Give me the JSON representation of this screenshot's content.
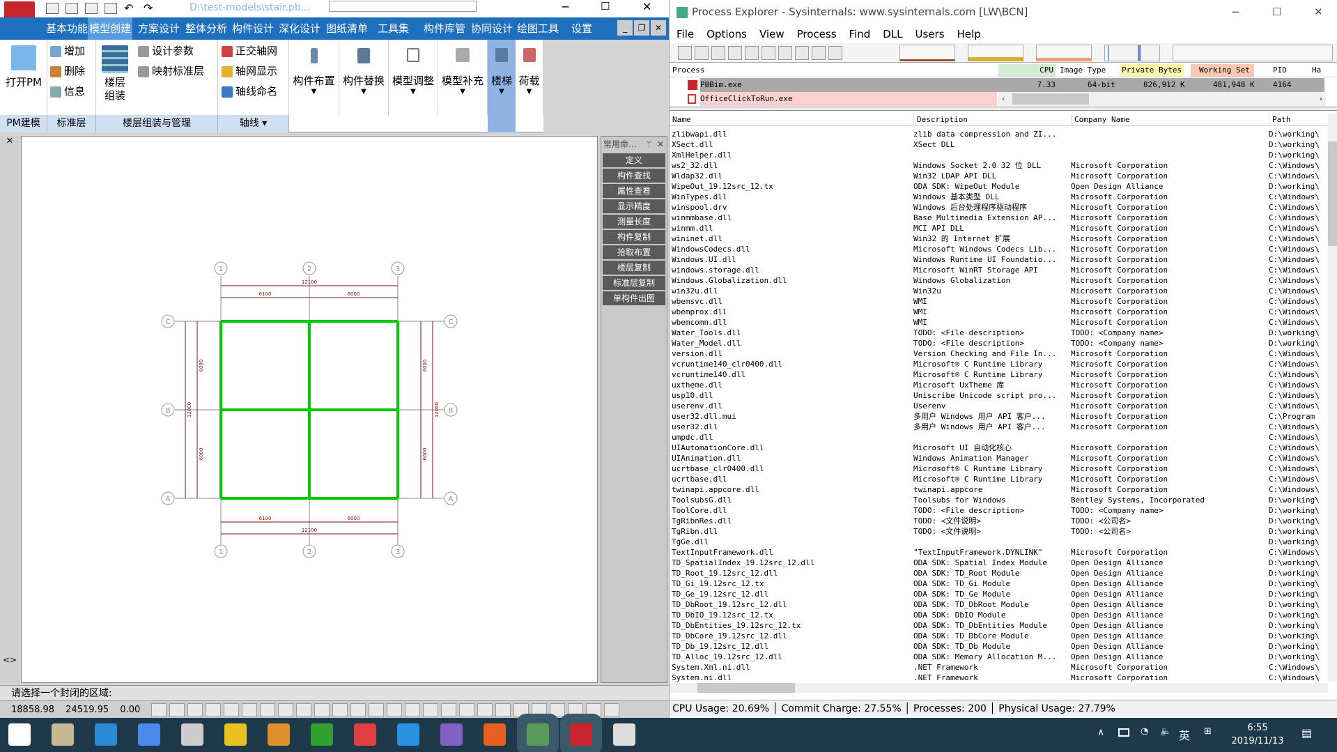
{
  "left_app": {
    "file_path": "D:\\test-models\\stair.pb...",
    "tabs": [
      "基本功能",
      "模型创建",
      "方案设计",
      "整体分析",
      "构件设计",
      "深化设计",
      "图纸清单",
      "工具集",
      "构件库管",
      "协同设计",
      "绘图工具",
      "设置"
    ],
    "selected_tab": "模型创建",
    "ribbon": {
      "open_pm": "打开PM",
      "add": "增加",
      "delete": "删除",
      "info": "信息",
      "floor_assembly": "楼层组装",
      "design_params": "设计参数",
      "map_std_floor": "映射标准层",
      "ortho_grid": "正交轴网",
      "grid_display": "轴网显示",
      "axis_naming": "轴线命名",
      "member_layout": "构件布置",
      "member_replace": "构件替换",
      "model_adjust": "模型调整",
      "model_supplement": "模型补充",
      "stair": "楼梯",
      "load": "荷载"
    },
    "groups": [
      "PM建模",
      "标准层",
      "楼层组装与管理",
      "轴线"
    ],
    "side_panel": {
      "title": "常用命...",
      "buttons": [
        "定义",
        "构件查找",
        "属性查看",
        "显示精度",
        "测量长度",
        "构件复制",
        "拾取布置",
        "楼层复制",
        "标准层复制",
        "单构件出图"
      ]
    },
    "drawing": {
      "col_labels": [
        "1",
        "2",
        "3"
      ],
      "row_labels": [
        "C",
        "B",
        "A"
      ],
      "dims_top": [
        "12100",
        "6100",
        "6000"
      ],
      "dims_bottom": [
        "12100",
        "6100",
        "6000"
      ],
      "dims_left": [
        "12000",
        "6000",
        "6000"
      ],
      "dims_right": [
        "12000",
        "6000",
        "6000"
      ],
      "beam_color": "#00c800"
    },
    "prompt": "请选择一个封闭的区域:",
    "coords": {
      "x": "18858.98",
      "y": "24519.95",
      "z": "0.00"
    }
  },
  "process_explorer": {
    "title": "Process Explorer - Sysinternals: www.sysinternals.com [LW\\BCN]",
    "menu": [
      "File",
      "Options",
      "View",
      "Process",
      "Find",
      "DLL",
      "Users",
      "Help"
    ],
    "process_columns": [
      "Process",
      "CPU",
      "Image Type",
      "Private Bytes",
      "Working Set",
      "PID",
      "Ha"
    ],
    "processes": [
      {
        "name": "PBBim.exe",
        "cpu": "7.33",
        "image_type": "64-bit",
        "private_bytes": "826,912 K",
        "working_set": "481,948 K",
        "pid": "4164"
      },
      {
        "name": "OfficeClickToRun.exe"
      }
    ],
    "dll_columns": [
      "Name",
      "Description",
      "Company Name",
      "Path"
    ],
    "dlls": [
      [
        "zlibwapi.dll",
        "zlib data compression and ZI...",
        "",
        "D:\\working\\"
      ],
      [
        "XSect.dll",
        "XSect DLL",
        "",
        "D:\\working\\"
      ],
      [
        "XmlHelper.dll",
        "",
        "",
        "D:\\working\\"
      ],
      [
        "ws2_32.dll",
        "Windows Socket 2.0 32 位 DLL",
        "Microsoft Corporation",
        "C:\\Windows\\"
      ],
      [
        "Wldap32.dll",
        "Win32 LDAP API DLL",
        "Microsoft Corporation",
        "C:\\Windows\\"
      ],
      [
        "WipeOut_19.12src_12.tx",
        "ODA SDK: WipeOut Module",
        "Open Design Alliance",
        "D:\\working\\"
      ],
      [
        "WinTypes.dll",
        "Windows 基本类型 DLL",
        "Microsoft Corporation",
        "C:\\Windows\\"
      ],
      [
        "winspool.drv",
        "Windows 后台处理程序驱动程序",
        "Microsoft Corporation",
        "C:\\Windows\\"
      ],
      [
        "winmmbase.dll",
        "Base Multimedia Extension AP...",
        "Microsoft Corporation",
        "C:\\Windows\\"
      ],
      [
        "winmm.dll",
        "MCI API DLL",
        "Microsoft Corporation",
        "C:\\Windows\\"
      ],
      [
        "wininet.dll",
        "Win32 的 Internet 扩展",
        "Microsoft Corporation",
        "C:\\Windows\\"
      ],
      [
        "WindowsCodecs.dll",
        "Microsoft Windows Codecs Lib...",
        "Microsoft Corporation",
        "C:\\Windows\\"
      ],
      [
        "Windows.UI.dll",
        "Windows Runtime UI Foundatio...",
        "Microsoft Corporation",
        "C:\\Windows\\"
      ],
      [
        "windows.storage.dll",
        "Microsoft WinRT Storage API",
        "Microsoft Corporation",
        "C:\\Windows\\"
      ],
      [
        "Windows.Globalization.dll",
        "Windows Globalization",
        "Microsoft Corporation",
        "C:\\Windows\\"
      ],
      [
        "win32u.dll",
        "Win32u",
        "Microsoft Corporation",
        "C:\\Windows\\"
      ],
      [
        "wbemsvc.dll",
        "WMI",
        "Microsoft Corporation",
        "C:\\Windows\\"
      ],
      [
        "wbemprox.dll",
        "WMI",
        "Microsoft Corporation",
        "C:\\Windows\\"
      ],
      [
        "wbemcomn.dll",
        "WMI",
        "Microsoft Corporation",
        "C:\\Windows\\"
      ],
      [
        "Water_Tools.dll",
        "TODO: <File description>",
        "TODO: <Company name>",
        "D:\\working\\"
      ],
      [
        "Water_Model.dll",
        "TODO: <File description>",
        "TODO: <Company name>",
        "D:\\working\\"
      ],
      [
        "version.dll",
        "Version Checking and File In...",
        "Microsoft Corporation",
        "C:\\Windows\\"
      ],
      [
        "vcruntime140_clr0400.dll",
        "Microsoft® C Runtime Library",
        "Microsoft Corporation",
        "C:\\Windows\\"
      ],
      [
        "vcruntime140.dll",
        "Microsoft® C Runtime Library",
        "Microsoft Corporation",
        "C:\\Windows\\"
      ],
      [
        "uxtheme.dll",
        "Microsoft UxTheme 库",
        "Microsoft Corporation",
        "C:\\Windows\\"
      ],
      [
        "usp10.dll",
        "Uniscribe Unicode script pro...",
        "Microsoft Corporation",
        "C:\\Windows\\"
      ],
      [
        "userenv.dll",
        "Userenv",
        "Microsoft Corporation",
        "C:\\Windows\\"
      ],
      [
        "user32.dll.mui",
        "多用户 Windows 用户 API 客户...",
        "Microsoft Corporation",
        "C:\\Program"
      ],
      [
        "user32.dll",
        "多用户 Windows 用户 API 客户...",
        "Microsoft Corporation",
        "C:\\Windows\\"
      ],
      [
        "umpdc.dll",
        "",
        "",
        "C:\\Windows\\"
      ],
      [
        "UIAutomationCore.dll",
        "Microsoft UI 自动化核心",
        "Microsoft Corporation",
        "C:\\Windows\\"
      ],
      [
        "UIAnimation.dll",
        "Windows Animation Manager",
        "Microsoft Corporation",
        "C:\\Windows\\"
      ],
      [
        "ucrtbase_clr0400.dll",
        "Microsoft® C Runtime Library",
        "Microsoft Corporation",
        "C:\\Windows\\"
      ],
      [
        "ucrtbase.dll",
        "Microsoft® C Runtime Library",
        "Microsoft Corporation",
        "C:\\Windows\\"
      ],
      [
        "twinapi.appcore.dll",
        "twinapi.appcore",
        "Microsoft Corporation",
        "C:\\Windows\\"
      ],
      [
        "ToolsubsG.dll",
        "Toolsubs for Windows",
        "Bentley Systems, Incorporated",
        "D:\\working\\"
      ],
      [
        "ToolCore.dll",
        "TODO: <File description>",
        "TODO: <Company name>",
        "D:\\working\\"
      ],
      [
        "TgRibnRes.dll",
        "TODO: <文件说明>",
        "TODO: <公司名>",
        "D:\\working\\"
      ],
      [
        "TgRibn.dll",
        "TODO: <文件说明>",
        "TODO: <公司名>",
        "D:\\working\\"
      ],
      [
        "TgGe.dll",
        "",
        "",
        "D:\\working\\"
      ],
      [
        "TextInputFramework.dll",
        "\"TextInputFramework.DYNLINK\"",
        "Microsoft Corporation",
        "C:\\Windows\\"
      ],
      [
        "TD_SpatialIndex_19.12src_12.dll",
        "ODA SDK: Spatial Index Module",
        "Open Design Alliance",
        "D:\\working\\"
      ],
      [
        "TD_Root_19.12src_12.dll",
        "ODA SDK: TD_Root Module",
        "Open Design Alliance",
        "D:\\working\\"
      ],
      [
        "TD_Gi_19.12src_12.tx",
        "ODA SDK: TD_Gi Module",
        "Open Design Alliance",
        "D:\\working\\"
      ],
      [
        "TD_Ge_19.12src_12.dll",
        "ODA SDK: TD_Ge Module",
        "Open Design Alliance",
        "D:\\working\\"
      ],
      [
        "TD_DbRoot_19.12src_12.dll",
        "ODA SDK: TD_DbRoot Module",
        "Open Design Alliance",
        "D:\\working\\"
      ],
      [
        "TD_DbIO_19.12src_12.tx",
        "ODA SDK: DbIO Module",
        "Open Design Alliance",
        "D:\\working\\"
      ],
      [
        "TD_DbEntities_19.12src_12.tx",
        "ODA SDK: TD_DbEntities Module",
        "Open Design Alliance",
        "D:\\working\\"
      ],
      [
        "TD_DbCore_19.12src_12.dll",
        "ODA SDK: TD_DbCore Module",
        "Open Design Alliance",
        "D:\\working\\"
      ],
      [
        "TD_Db_19.12src_12.dll",
        "ODA SDK: TD_Db Module",
        "Open Design Alliance",
        "D:\\working\\"
      ],
      [
        "TD_Alloc_19.12src_12.dll",
        "ODA SDK: Memory Allocation M...",
        "Open Design Alliance",
        "D:\\working\\"
      ],
      [
        "System.Xml.ni.dll",
        ".NET Framework",
        "Microsoft Corporation",
        "C:\\Windows\\"
      ],
      [
        "System.ni.dll",
        ".NET Framework",
        "Microsoft Corporation",
        "C:\\Windows\\"
      ]
    ],
    "status": {
      "cpu": "CPU Usage: 20.69%",
      "commit": "Commit Charge: 27.55%",
      "processes": "Processes: 200",
      "physical": "Physical Usage: 27.79%"
    },
    "colors": {
      "cpu_header": "#d4ecd4",
      "private_header": "#fff3b0",
      "working_header": "#f8c8b0",
      "selected_row": "#a9a9a9",
      "service_row": "#ffd0d0"
    }
  },
  "taskbar": {
    "icons": [
      "windows-start",
      "book",
      "telegram",
      "search-app",
      "chart-app",
      "puzzle",
      "calligraphy",
      "evernote",
      "calendar",
      "vscode",
      "visual-studio",
      "firefox",
      "process-explorer",
      "pbbim",
      "terminal"
    ],
    "ime": "英",
    "time": "6:55",
    "date": "2019/11/13"
  }
}
